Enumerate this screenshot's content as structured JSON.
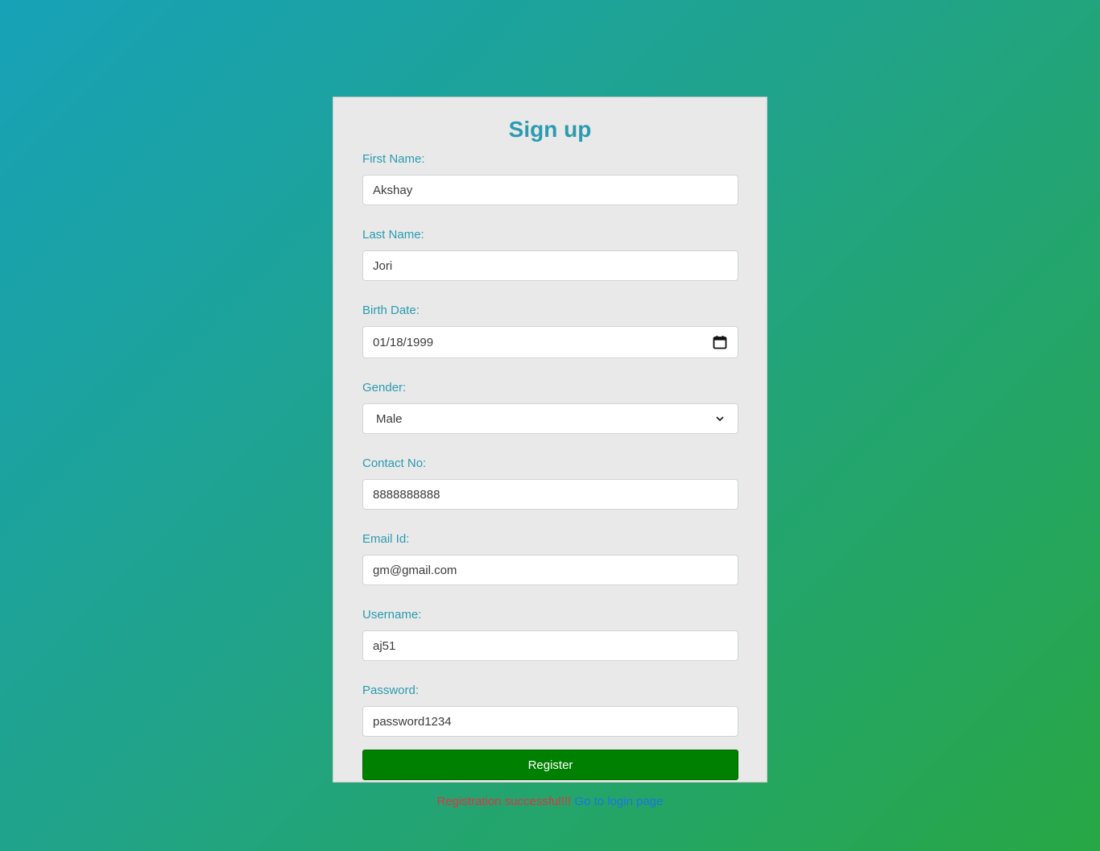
{
  "form": {
    "title": "Sign up",
    "fields": {
      "first_name": {
        "label": "First Name:",
        "value": "Akshay"
      },
      "last_name": {
        "label": "Last Name:",
        "value": "Jori"
      },
      "birth_date": {
        "label": "Birth Date:",
        "value": "01/18/1999"
      },
      "gender": {
        "label": "Gender:",
        "value": "Male"
      },
      "contact": {
        "label": "Contact No:",
        "value": "8888888888"
      },
      "email": {
        "label": "Email Id:",
        "value": "gm@gmail.com"
      },
      "username": {
        "label": "Username:",
        "value": "aj51"
      },
      "password": {
        "label": "Password:",
        "value": "password1234"
      }
    },
    "register_label": "Register",
    "status_message": "Registration successful!!!",
    "login_link": "Go to login page"
  },
  "colors": {
    "label": "#2a9bb0",
    "register_bg": "#008000",
    "success": "#dc3545",
    "link": "#1a73e8"
  },
  "icons": {
    "date_picker": "calendar-icon",
    "select": "chevron-down-icon"
  }
}
